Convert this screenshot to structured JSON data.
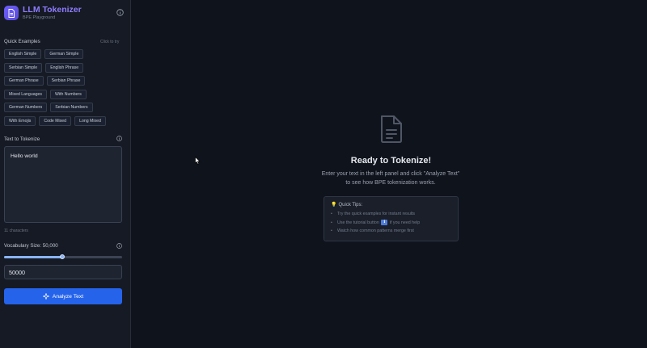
{
  "app": {
    "title": "LLM Tokenizer",
    "subtitle": "BPE Playground"
  },
  "icons": {
    "logo": "file-text-icon",
    "info": "info-icon",
    "analyze": "sparkle-icon",
    "ready": "document-icon",
    "tips": "lightbulb-icon",
    "tutorial": "info-icon"
  },
  "quick_examples": {
    "title": "Quick Examples",
    "hint": "Click to try",
    "rows": [
      [
        "English Simple",
        "German Simple"
      ],
      [
        "Serbian Simple",
        "English Phrase"
      ],
      [
        "German Phrase",
        "Serbian Phrase"
      ],
      [
        "Mixed Languages",
        "With Numbers"
      ],
      [
        "German Numbers",
        "Serbian Numbers"
      ],
      [
        "With Emojis",
        "Code Mixed",
        "Long Mixed"
      ]
    ]
  },
  "text_input": {
    "label": "Text to Tokenize",
    "value": "Hello world",
    "char_count": "11 characters"
  },
  "vocab": {
    "label": "Vocabulary Size: 50,000",
    "value": "50000",
    "slider_fraction": 0.49
  },
  "analyze_button": {
    "label": "Analyze Text"
  },
  "ready": {
    "title": "Ready to Tokenize!",
    "description": "Enter your text in the left panel and click \"Analyze Text\" to see how BPE tokenization works."
  },
  "tips": {
    "title": "Quick Tips:",
    "items": [
      {
        "text": "Try the quick examples for instant results"
      },
      {
        "before": "Use the tutorial button",
        "after": "if you need help"
      },
      {
        "text": "Watch how common patterns merge first"
      }
    ]
  },
  "colors": {
    "accent": "#8f7dff",
    "button": "#2563eb",
    "slider": "#8ab4f8",
    "background": "#0f131c",
    "sidebar": "#151a24"
  }
}
